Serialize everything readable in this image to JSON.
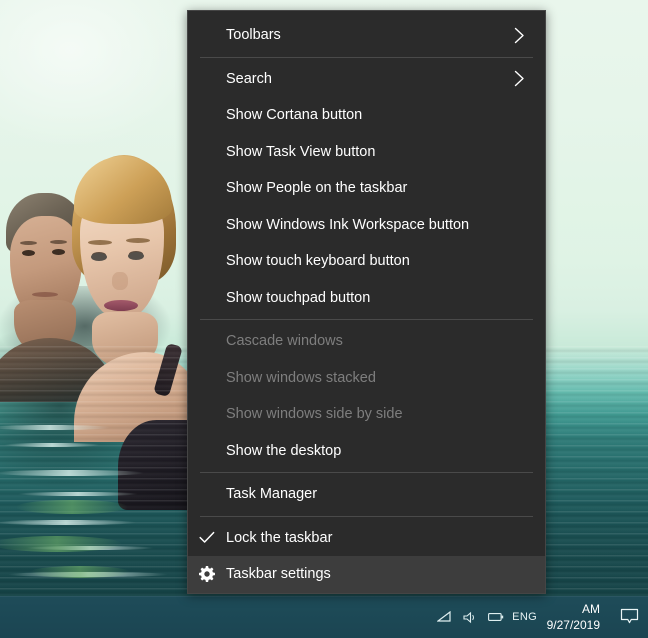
{
  "desktop": {
    "wallpaper_description": "photo of a man and a woman in greenish water",
    "wallpaper_colors": {
      "sky": "#e6f5ea",
      "water_deep": "#184c50",
      "water_highlight": "#8fd4c6"
    }
  },
  "taskbar": {
    "background_color": "#1d4a56",
    "tray_icons": [
      {
        "name": "network-icon",
        "glyph": "◭"
      },
      {
        "name": "volume-icon",
        "glyph": "🔊"
      },
      {
        "name": "battery-icon",
        "glyph": "▬"
      },
      {
        "name": "language-indicator",
        "glyph": "ENG"
      }
    ],
    "clock": {
      "time_suffix": "AM",
      "date": "9/27/2019"
    },
    "action_center": {
      "name": "action-center-icon",
      "label": "Action Center"
    }
  },
  "context_menu": {
    "background_color": "#2b2b2b",
    "border_color": "#454545",
    "highlight_color": "#3d3d3d",
    "disabled_text_color": "#7e7e7e",
    "items": [
      {
        "id": "toolbars",
        "label": "Toolbars",
        "submenu": true,
        "disabled": false,
        "checked": false,
        "icon": null,
        "highlighted": false
      },
      {
        "type": "separator"
      },
      {
        "id": "search",
        "label": "Search",
        "submenu": true,
        "disabled": false,
        "checked": false,
        "icon": null,
        "highlighted": false
      },
      {
        "id": "show-cortana",
        "label": "Show Cortana button",
        "submenu": false,
        "disabled": false,
        "checked": false,
        "icon": null,
        "highlighted": false
      },
      {
        "id": "show-task-view",
        "label": "Show Task View button",
        "submenu": false,
        "disabled": false,
        "checked": false,
        "icon": null,
        "highlighted": false
      },
      {
        "id": "show-people",
        "label": "Show People on the taskbar",
        "submenu": false,
        "disabled": false,
        "checked": false,
        "icon": null,
        "highlighted": false
      },
      {
        "id": "show-ink-workspace",
        "label": "Show Windows Ink Workspace button",
        "submenu": false,
        "disabled": false,
        "checked": false,
        "icon": null,
        "highlighted": false
      },
      {
        "id": "show-touch-keyboard",
        "label": "Show touch keyboard button",
        "submenu": false,
        "disabled": false,
        "checked": false,
        "icon": null,
        "highlighted": false
      },
      {
        "id": "show-touchpad",
        "label": "Show touchpad button",
        "submenu": false,
        "disabled": false,
        "checked": false,
        "icon": null,
        "highlighted": false
      },
      {
        "type": "separator"
      },
      {
        "id": "cascade-windows",
        "label": "Cascade windows",
        "submenu": false,
        "disabled": true,
        "checked": false,
        "icon": null,
        "highlighted": false
      },
      {
        "id": "show-windows-stacked",
        "label": "Show windows stacked",
        "submenu": false,
        "disabled": true,
        "checked": false,
        "icon": null,
        "highlighted": false
      },
      {
        "id": "show-windows-side",
        "label": "Show windows side by side",
        "submenu": false,
        "disabled": true,
        "checked": false,
        "icon": null,
        "highlighted": false
      },
      {
        "id": "show-the-desktop",
        "label": "Show the desktop",
        "submenu": false,
        "disabled": false,
        "checked": false,
        "icon": null,
        "highlighted": false
      },
      {
        "type": "separator"
      },
      {
        "id": "task-manager",
        "label": "Task Manager",
        "submenu": false,
        "disabled": false,
        "checked": false,
        "icon": null,
        "highlighted": false
      },
      {
        "type": "separator"
      },
      {
        "id": "lock-the-taskbar",
        "label": "Lock the taskbar",
        "submenu": false,
        "disabled": false,
        "checked": true,
        "icon": "check-icon",
        "highlighted": false
      },
      {
        "id": "taskbar-settings",
        "label": "Taskbar settings",
        "submenu": false,
        "disabled": false,
        "checked": false,
        "icon": "gear-icon",
        "highlighted": true
      }
    ]
  }
}
